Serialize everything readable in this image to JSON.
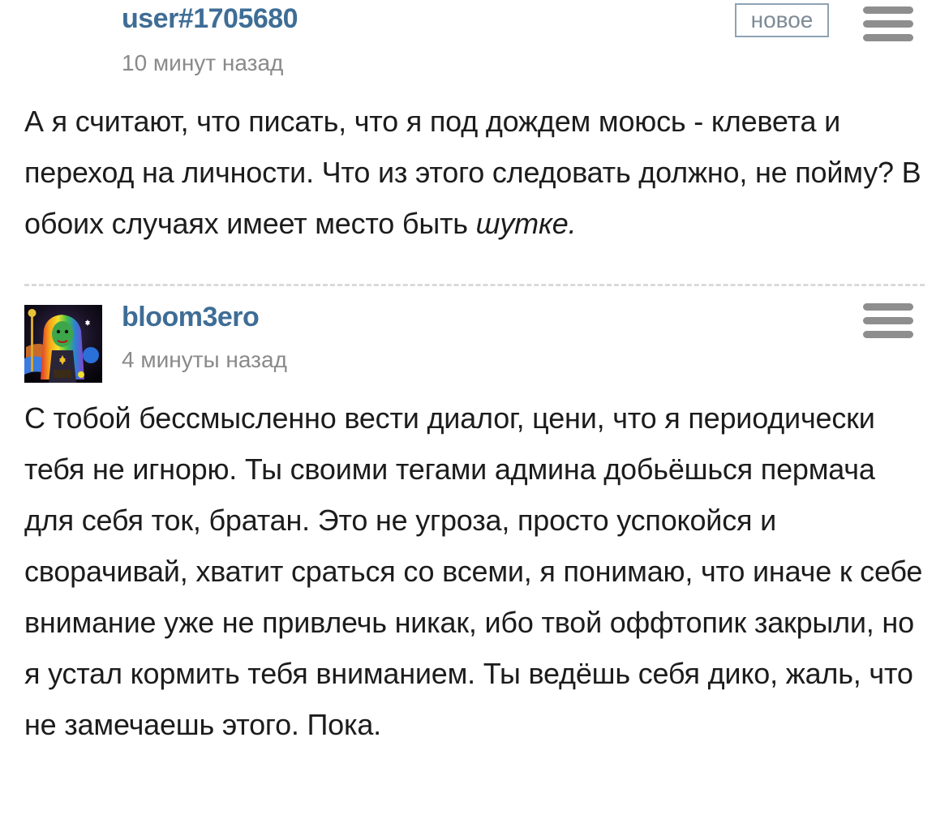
{
  "comments": [
    {
      "username": "user#1705680",
      "timestamp": "10 минут назад",
      "badge": "новое",
      "text": "А я считают, что писать, что я под дождем моюсь - клевета и переход на личности. Что из этого следовать должно, не пойму? В обоих случаях имеет место быть ",
      "text_emphasis": "шутке."
    },
    {
      "username": "bloom3ero",
      "timestamp": "4 минуты назад",
      "avatar": "user-avatar-image",
      "text": "С тобой бессмысленно вести диалог, цени, что я периодически тебя не игнорю. Ты своими тегами админа добьёшься пермача для себя ток, братан. Это не угроза, просто успокойся и сворачивай, хватит сраться со всеми, я понимаю, что иначе к себе внимание уже не привлечь никак, ибо твой оффтопик закрыли, но я устал кормить тебя вниманием. Ты ведёшь себя дико, жаль, что не замечаешь этого. Пока."
    }
  ],
  "colors": {
    "username": "#3e6d96",
    "timestamp": "#8a8a8a",
    "menu_icon": "#8e8e8e",
    "divider": "#dadada"
  },
  "icons": {
    "menu": "hamburger-menu-icon"
  }
}
